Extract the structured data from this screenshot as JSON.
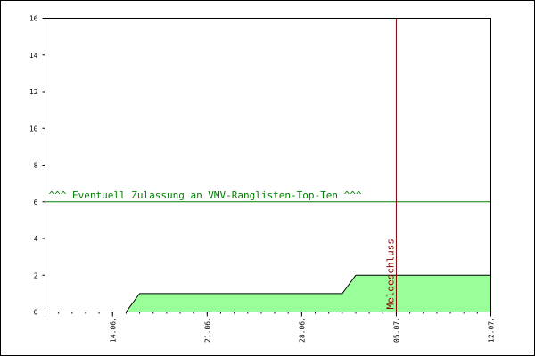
{
  "chart_data": {
    "type": "area",
    "title": "",
    "xlabel": "",
    "ylabel": "",
    "ylim": [
      0,
      16
    ],
    "y_ticks": [
      "0",
      "2",
      "4",
      "6",
      "8",
      "10",
      "12",
      "14",
      "16"
    ],
    "x_tick_labels": [
      "14.06.",
      "21.06.",
      "28.06.",
      "05.07.",
      "12.07."
    ],
    "x_range": [
      "2012-06-09",
      "2012-07-12"
    ],
    "grid": false,
    "series": [
      {
        "points": [
          [
            "2012-06-09",
            0
          ],
          [
            "2012-06-14",
            0
          ],
          [
            "2012-06-15",
            0
          ],
          [
            "2012-06-16",
            1
          ],
          [
            "2012-06-30",
            1
          ],
          [
            "2012-07-01",
            1
          ],
          [
            "2012-07-02",
            2
          ],
          [
            "2012-07-12",
            2
          ]
        ],
        "fill_color": "#99ff99",
        "line_color": "#000000"
      }
    ],
    "annotations": [
      {
        "type": "hline",
        "y": 6,
        "label": "^^^ Eventuell Zulassung an VMV-Ranglisten-Top-Ten ^^^",
        "color": "#008000"
      },
      {
        "type": "vline",
        "x": "2012-07-05",
        "label": "Meldeschluss",
        "color": "#800000"
      }
    ]
  }
}
